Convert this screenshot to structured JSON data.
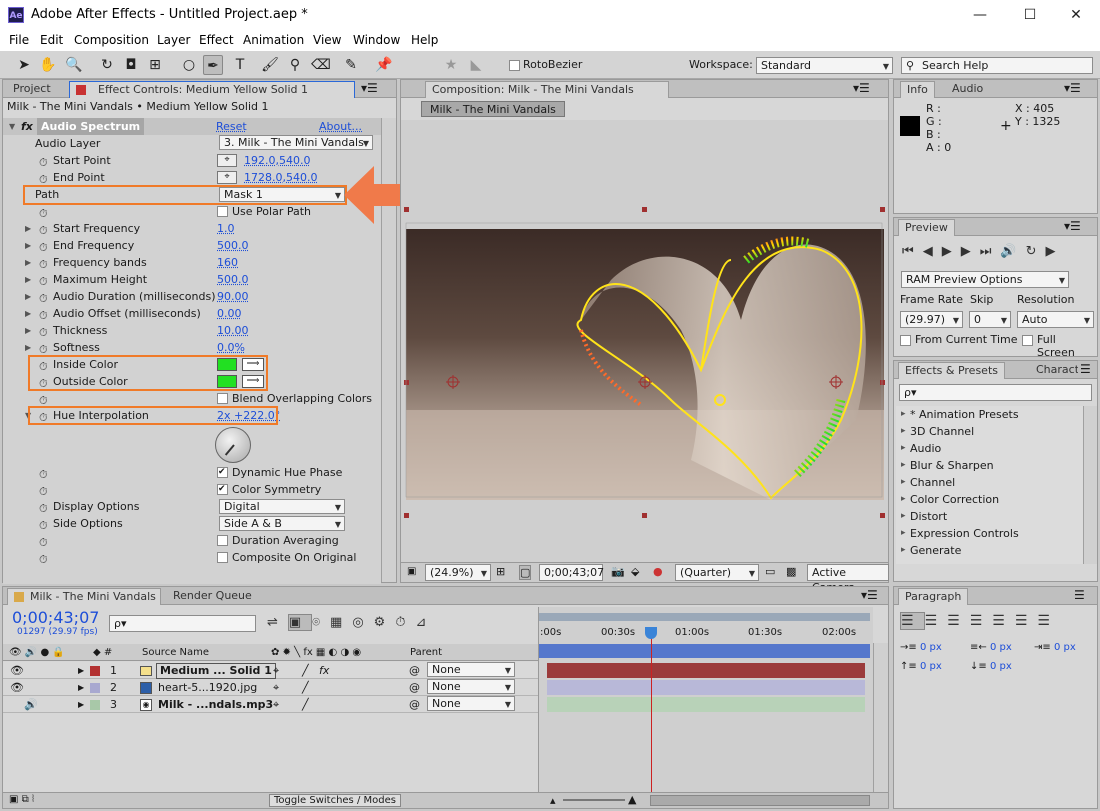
{
  "app": {
    "title": "Adobe After Effects - Untitled Project.aep *",
    "logo": "Ae"
  },
  "menu": [
    "File",
    "Edit",
    "Composition",
    "Layer",
    "Effect",
    "Animation",
    "View",
    "Window",
    "Help"
  ],
  "toolbar": {
    "rotobezier": "RotoBezier",
    "workspace_label": "Workspace:",
    "workspace_value": "Standard",
    "search_placeholder": "Search Help"
  },
  "effect_panel": {
    "tab_project": "Project",
    "tab_effect": "Effect Controls: Medium Yellow Solid 1",
    "breadcrumb": "Milk - The Mini Vandals • Medium Yellow Solid 1",
    "effect_name": "Audio Spectrum",
    "reset": "Reset",
    "about": "About...",
    "audio_layer_label": "Audio Layer",
    "audio_layer_value": "3. Milk - The Mini Vandals",
    "start_point_label": "Start Point",
    "start_point_value": "192.0,540.0",
    "end_point_label": "End Point",
    "end_point_value": "1728.0,540.0",
    "path_label": "Path",
    "path_value": "Mask 1",
    "use_polar": "Use Polar Path",
    "params": [
      {
        "label": "Start Frequency",
        "value": "1.0"
      },
      {
        "label": "End Frequency",
        "value": "500.0"
      },
      {
        "label": "Frequency bands",
        "value": "160"
      },
      {
        "label": "Maximum Height",
        "value": "500.0"
      },
      {
        "label": "Audio Duration (milliseconds)",
        "value": "90.00"
      },
      {
        "label": "Audio Offset (milliseconds)",
        "value": "0.00"
      },
      {
        "label": "Thickness",
        "value": "10.00"
      },
      {
        "label": "Softness",
        "value": "0.0%"
      }
    ],
    "inside_color": "Inside Color",
    "outside_color": "Outside Color",
    "color_value": "#22e022",
    "blend": "Blend Overlapping Colors",
    "hue_label": "Hue Interpolation",
    "hue_value": "2x +222.0°",
    "dynamic_hue": "Dynamic Hue Phase",
    "color_symmetry": "Color Symmetry",
    "display_label": "Display Options",
    "display_value": "Digital",
    "side_label": "Side Options",
    "side_value": "Side A & B",
    "duration_avg": "Duration Averaging",
    "composite": "Composite On Original"
  },
  "comp_panel": {
    "tab": "Composition: Milk - The Mini Vandals",
    "subtab": "Milk - The Mini Vandals",
    "zoom": "(24.9%)",
    "timecode": "0;00;43;07",
    "resolution": "(Quarter)",
    "camera": "Active Camera"
  },
  "info_panel": {
    "tab_info": "Info",
    "tab_audio": "Audio",
    "r": "R :",
    "g": "G :",
    "b": "B :",
    "a": "A : 0",
    "x": "X : 405",
    "y": "Y : 1325"
  },
  "preview_panel": {
    "tab": "Preview",
    "ram": "RAM Preview Options",
    "frame_rate_label": "Frame Rate",
    "skip_label": "Skip",
    "resolution_label": "Resolution",
    "frame_rate": "(29.97)",
    "skip": "0",
    "resolution": "Auto",
    "from_current": "From Current Time",
    "full_screen": "Full Screen"
  },
  "effects_presets": {
    "tab": "Effects & Presets",
    "tab2": "Characte",
    "search": "ρ▾",
    "items": [
      "* Animation Presets",
      "3D Channel",
      "Audio",
      "Blur & Sharpen",
      "Channel",
      "Color Correction",
      "Distort",
      "Expression Controls",
      "Generate"
    ]
  },
  "timeline": {
    "tab": "Milk - The Mini Vandals",
    "tab2": "Render Queue",
    "timecode": "0;00;43;07",
    "frame_info": "01297 (29.97 fps)",
    "search": "ρ▾",
    "col_source": "Source Name",
    "col_parent": "Parent",
    "ruler": [
      ":00s",
      "00:30s",
      "01:00s",
      "01:30s",
      "02:00s"
    ],
    "layers": [
      {
        "num": "1",
        "name": "Medium ... Solid 1",
        "label_color": "#b33232",
        "parent": "None",
        "bar_color": "#9b3b3b"
      },
      {
        "num": "2",
        "name": "heart-5...1920.jpg",
        "label_color": "#a8a8d0",
        "parent": "None",
        "bar_color": "#b8b8d8"
      },
      {
        "num": "3",
        "name": "Milk - ...ndals.mp3",
        "label_color": "#a8c8a8",
        "parent": "None",
        "bar_color": "#b8d2b8"
      }
    ],
    "toggle": "Toggle Switches / Modes"
  },
  "paragraph_panel": {
    "tab": "Paragraph",
    "v1": "0 px",
    "v2": "0 px",
    "v3": "0 px",
    "v4": "0 px",
    "v5": "0 px"
  }
}
